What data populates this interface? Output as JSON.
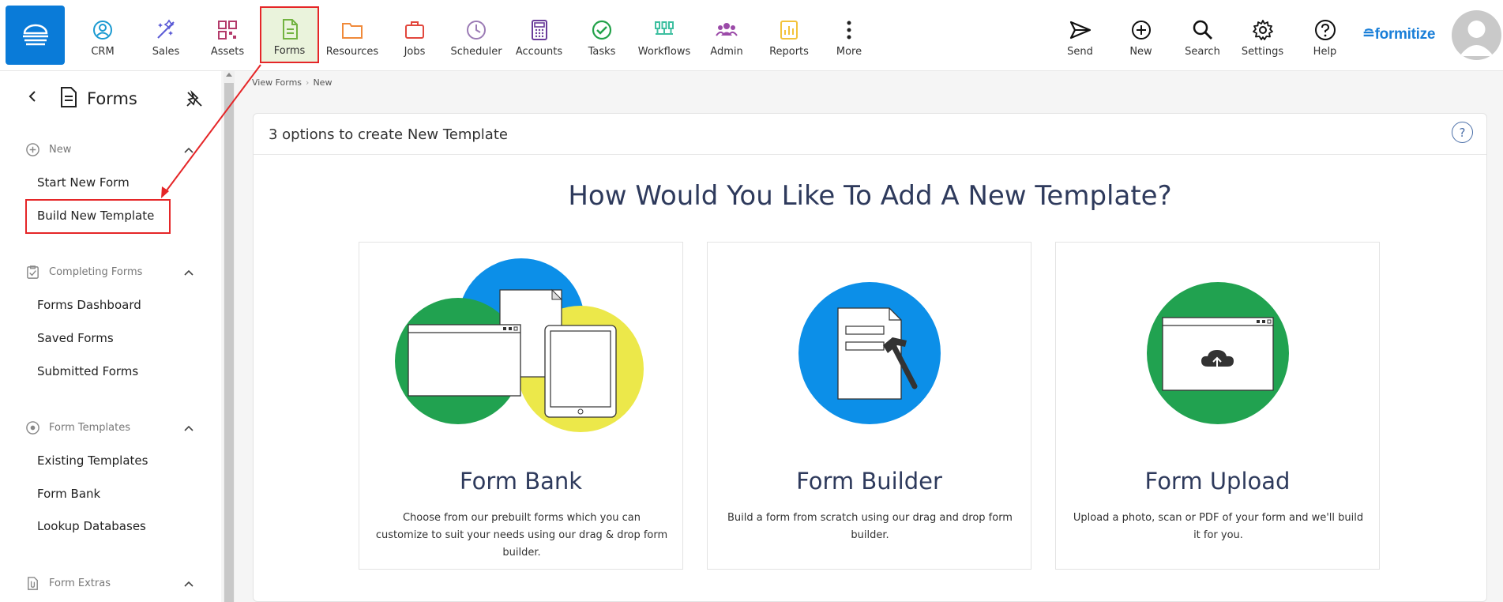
{
  "nav": {
    "items": [
      {
        "label": "CRM",
        "icon": "crm-icon"
      },
      {
        "label": "Sales",
        "icon": "sales-icon"
      },
      {
        "label": "Assets",
        "icon": "assets-icon"
      },
      {
        "label": "Forms",
        "icon": "forms-icon"
      },
      {
        "label": "Resources",
        "icon": "folder-icon"
      },
      {
        "label": "Jobs",
        "icon": "briefcase-icon"
      },
      {
        "label": "Scheduler",
        "icon": "clock-icon"
      },
      {
        "label": "Accounts",
        "icon": "calculator-icon"
      },
      {
        "label": "Tasks",
        "icon": "check-circle-icon"
      },
      {
        "label": "Workflows",
        "icon": "workflow-icon"
      },
      {
        "label": "Admin",
        "icon": "users-icon"
      },
      {
        "label": "Reports",
        "icon": "report-icon"
      },
      {
        "label": "More",
        "icon": "more-vertical-icon"
      }
    ],
    "right": [
      {
        "label": "Send",
        "icon": "send-icon"
      },
      {
        "label": "New",
        "icon": "plus-circle-icon"
      },
      {
        "label": "Search",
        "icon": "search-icon"
      },
      {
        "label": "Settings",
        "icon": "gear-icon"
      },
      {
        "label": "Help",
        "icon": "help-circle-icon"
      }
    ],
    "brand": "≘formitize"
  },
  "sidebar": {
    "title": "Forms",
    "sections": [
      {
        "label": "New",
        "items": [
          "Start New Form",
          "Build New Template"
        ]
      },
      {
        "label": "Completing Forms",
        "items": [
          "Forms Dashboard",
          "Saved Forms",
          "Submitted Forms"
        ]
      },
      {
        "label": "Form Templates",
        "items": [
          "Existing Templates",
          "Form Bank",
          "Lookup Databases"
        ]
      },
      {
        "label": "Form Extras",
        "items": []
      }
    ]
  },
  "breadcrumb": {
    "items": [
      "View Forms",
      "New"
    ],
    "separator": "›"
  },
  "main": {
    "card_title": "3 options to create New Template",
    "help": "?",
    "heading": "How Would You Like To Add A New Template?",
    "options": [
      {
        "title": "Form Bank",
        "desc": "Choose from our prebuilt forms which you can customize to suit your needs using our drag & drop form builder."
      },
      {
        "title": "Form Builder",
        "desc": "Build a form from scratch using our drag and drop form builder."
      },
      {
        "title": "Form Upload",
        "desc": "Upload a photo, scan or PDF of your form and we'll build it for you."
      }
    ]
  },
  "colors": {
    "accent": "#0a7bd8",
    "highlight": "#e52628",
    "forms_bg": "#eaf3dc",
    "heading": "#2e3a5c",
    "green": "#21a250",
    "blue": "#0c8fe8",
    "yellow": "#ece84a"
  }
}
